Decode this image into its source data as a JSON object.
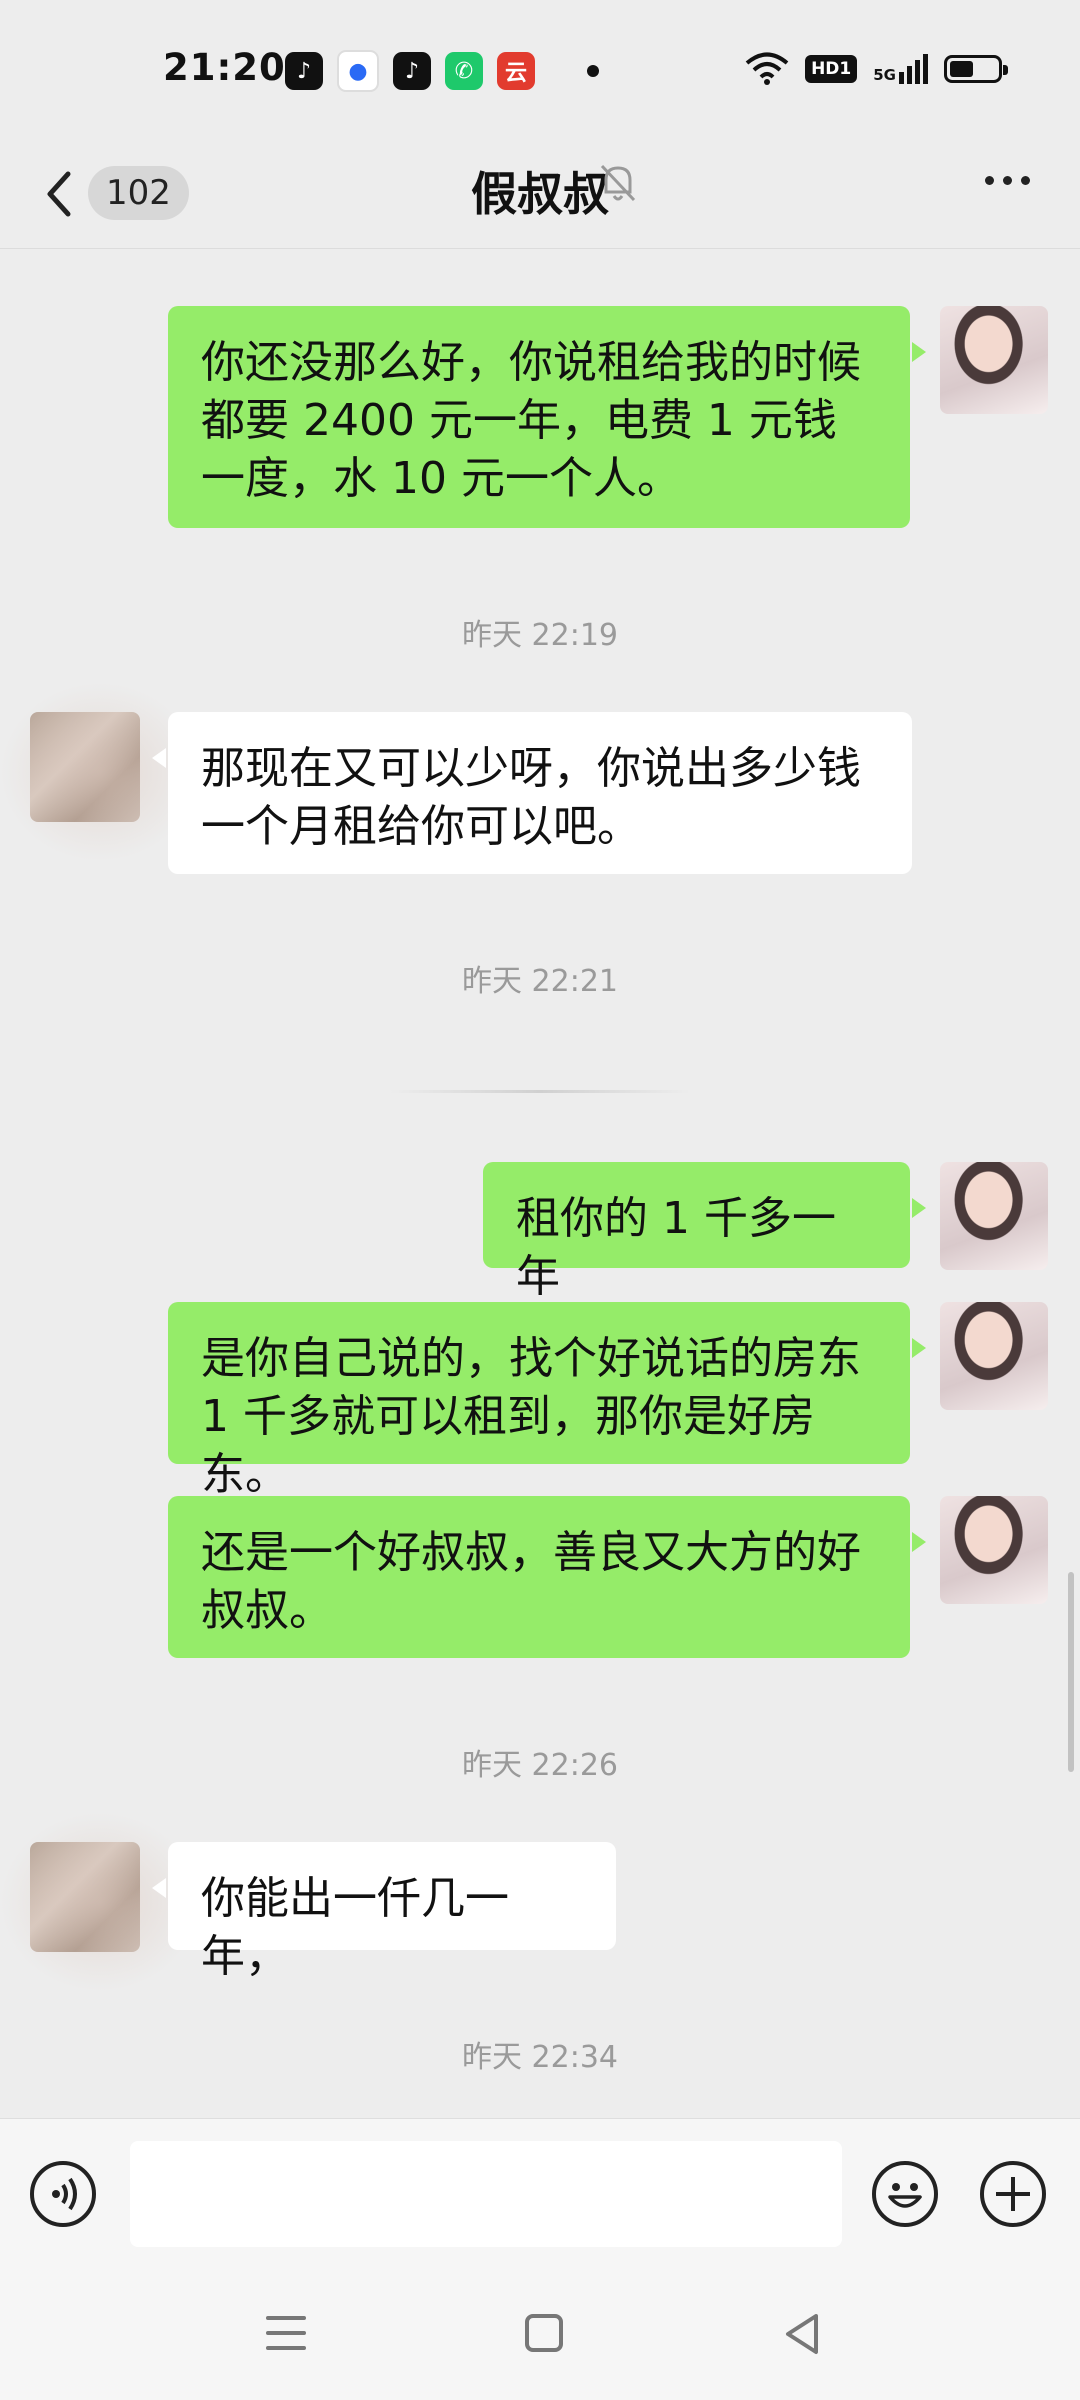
{
  "status_bar": {
    "time": "21:20",
    "app_icons": [
      "douyin-lite-icon",
      "baidu-icon",
      "douyin-icon",
      "phone-icon",
      "yunshanfu-icon"
    ],
    "network": "5G",
    "hd_label": "HD1",
    "battery_percent": 50
  },
  "header": {
    "unread_count": "102",
    "title": "假叔叔"
  },
  "messages": [
    {
      "sender": "me",
      "text": "你还没那么好，你说租给我的时候都要 2400 元一年，电费 1 元钱一度，水 10 元一个人。"
    },
    {
      "timestamp": "昨天 22:19"
    },
    {
      "sender": "them",
      "text": "那现在又可以少呀，你说出多少钱一个月租给你可以吧。"
    },
    {
      "timestamp": "昨天 22:21"
    },
    {
      "sender": "me",
      "text": "租你的 1 千多一年"
    },
    {
      "sender": "me",
      "text": "是你自己说的，找个好说话的房东 1 千多就可以租到，那你是好房东。"
    },
    {
      "sender": "me",
      "text": "还是一个好叔叔，善良又大方的好叔叔。"
    },
    {
      "timestamp": "昨天 22:26"
    },
    {
      "sender": "them",
      "text": "你能出一仟几一年，"
    },
    {
      "timestamp": "昨天 22:34"
    }
  ],
  "input_bar": {
    "text_value": ""
  },
  "colors": {
    "my_bubble": "#95ec69",
    "their_bubble": "#ffffff",
    "background": "#ededed"
  }
}
